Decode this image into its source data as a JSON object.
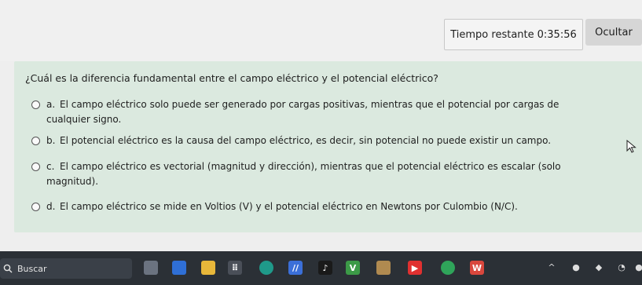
{
  "timer": {
    "label": "Tiempo restante",
    "value": "0:35:56"
  },
  "hide_button": "Ocultar",
  "question": {
    "text": "¿Cuál es la diferencia fundamental entre el campo eléctrico y el potencial eléctrico?",
    "options": [
      {
        "letter": "a.",
        "text": "El campo eléctrico solo puede ser generado por cargas positivas, mientras que el potencial por cargas de",
        "cont": "cualquier signo."
      },
      {
        "letter": "b.",
        "text": "El potencial eléctrico es la causa del campo eléctrico, es decir, sin potencial no puede existir un campo."
      },
      {
        "letter": "c.",
        "text": "El campo eléctrico es vectorial (magnitud y dirección), mientras que el potencial eléctrico es escalar (solo",
        "cont": "magnitud)."
      },
      {
        "letter": "d.",
        "text": "El campo eléctrico se mide en Voltios (V) y el potencial eléctrico en Newtons por Culombio (N/C)."
      }
    ]
  },
  "taskbar": {
    "search_label": "Buscar",
    "apps": [
      {
        "name": "app-icon-1",
        "color": "#6b7380",
        "glyph": ""
      },
      {
        "name": "app-icon-2",
        "color": "#2f6fd6",
        "glyph": ""
      },
      {
        "name": "folder-icon",
        "color": "#e8b73a",
        "glyph": ""
      },
      {
        "name": "store-icon",
        "color": "#4a4f58",
        "glyph": "⠿"
      },
      {
        "name": "edge-icon",
        "color": "#1f9a8a",
        "glyph": ""
      },
      {
        "name": "app-icon-6",
        "color": "#3b6fd8",
        "glyph": "//"
      },
      {
        "name": "tiktok-icon",
        "color": "#1a1a1a",
        "glyph": "♪"
      },
      {
        "name": "app-icon-8",
        "color": "#3c9a47",
        "glyph": "V"
      },
      {
        "name": "app-icon-9",
        "color": "#b08a50",
        "glyph": ""
      },
      {
        "name": "youtube-icon",
        "color": "#e03030",
        "glyph": "▶"
      },
      {
        "name": "chrome-icon",
        "color": "#2fa45a",
        "glyph": ""
      },
      {
        "name": "word-icon",
        "color": "#d9473d",
        "glyph": "W"
      }
    ],
    "tray": [
      {
        "name": "chevron-up-icon",
        "glyph": "^"
      },
      {
        "name": "tray-icon-1",
        "glyph": "●"
      },
      {
        "name": "tray-icon-2",
        "glyph": "◆"
      },
      {
        "name": "tray-icon-3",
        "glyph": "◔"
      },
      {
        "name": "tray-icon-4",
        "glyph": "●"
      }
    ]
  }
}
